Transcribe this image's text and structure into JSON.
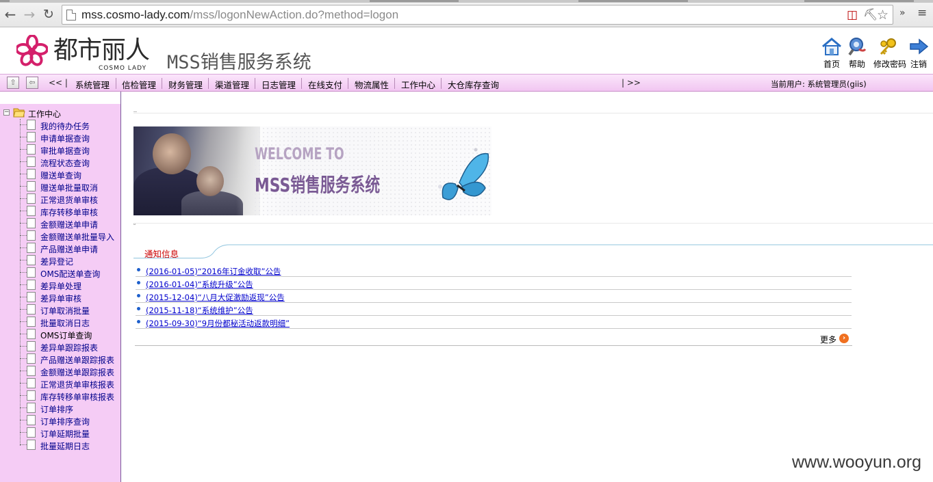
{
  "browser": {
    "url_host": "mss.cosmo-lady.com",
    "url_path": "/mss/logonNewAction.do?method=logon",
    "more_tools": "»"
  },
  "header": {
    "logo_cn": "都市丽人",
    "logo_en": "COSMO LADY",
    "system_title": "MSS销售服务系统",
    "buttons": [
      {
        "label": "首页",
        "icon": "home-icon"
      },
      {
        "label": "帮助",
        "icon": "help-icon"
      },
      {
        "label": "修改密码",
        "icon": "key-icon"
      },
      {
        "label": "注销",
        "icon": "logout-arrow-icon"
      }
    ]
  },
  "menubar": {
    "prev": "<< |",
    "next": "| >>",
    "items": [
      "系统管理",
      "信检管理",
      "财务管理",
      "渠道管理",
      "日志管理",
      "在线支付",
      "物流属性",
      "工作中心",
      "大仓库存查询"
    ],
    "current_user": "当前用户: 系统管理员(giis)"
  },
  "sidebar": {
    "root": "工作中心",
    "items": [
      "我的待办任务",
      "申请单据查询",
      "审批单据查询",
      "流程状态查询",
      "赠送单查询",
      "赠送单批量取消",
      "正常退货单审核",
      "库存转移单审核",
      "金额赠送单申请",
      "金额赠送单批量导入",
      "产品赠送单申请",
      "差异登记",
      "OMS配送单查询",
      "差异单处理",
      "差异单审核",
      "订单取消批量",
      "批量取消日志",
      "OMS订单查询",
      "差异单跟踪报表",
      "产品赠送单跟踪报表",
      "金额赠送单跟踪报表",
      "正常退货单审核报表",
      "库存转移单审核报表",
      "订单排序",
      "订单排序查询",
      "订单延期批量",
      "批量延期日志"
    ]
  },
  "banner": {
    "welcome": "WELCOME TO",
    "title": "MSS销售服务系统"
  },
  "notice": {
    "tab_label": "通知信息",
    "items": [
      "(2016-01-05)“2016年订金收取”公告",
      "(2016-01-04)“系统升级”公告",
      "(2015-12-04)“八月大促激励返现”公告",
      "(2015-11-18)“系统维护”公告",
      "(2015-09-30)“9月份都秘活动返款明细”"
    ],
    "more_label": "更多"
  },
  "watermark": "www.wooyun.org",
  "colors": {
    "menubar": "#f1c6f1",
    "sidebar": "#f5ccf5",
    "link": "#0000cc",
    "notice_tab": "#cc0000"
  }
}
